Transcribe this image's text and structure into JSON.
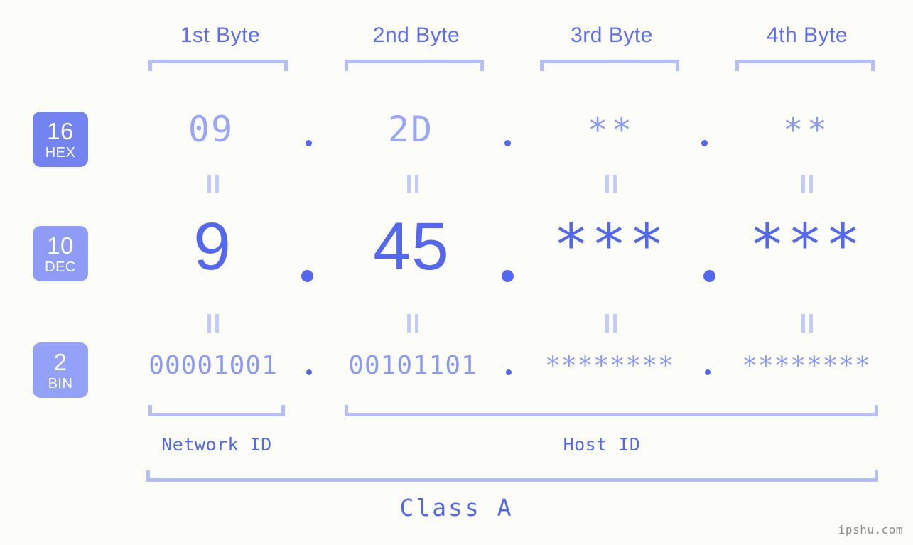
{
  "background_color": "#fcfdf9",
  "accent_strong": "#5368ef",
  "accent_mid": "#8b99f6",
  "accent_light": "#b6bef9",
  "header": {
    "bytes": [
      {
        "label": "1st Byte"
      },
      {
        "label": "2nd Byte"
      },
      {
        "label": "3rd Byte"
      },
      {
        "label": "4th Byte"
      }
    ]
  },
  "bases": [
    {
      "number": "16",
      "name": "HEX",
      "color": "#7384f0"
    },
    {
      "number": "10",
      "name": "DEC",
      "color": "#8f9cf5"
    },
    {
      "number": "2",
      "name": "BIN",
      "color": "#93a2f7"
    }
  ],
  "rows": {
    "hex": {
      "values": [
        "09",
        "2D",
        "**",
        "**"
      ],
      "separator": "."
    },
    "dec": {
      "values": [
        "9",
        "45",
        "***",
        "***"
      ],
      "separator": "."
    },
    "bin": {
      "values": [
        "00001001",
        "00101101",
        "********",
        "********"
      ],
      "separator": "."
    }
  },
  "connector": "=",
  "footer": {
    "network_id_label": "Network ID",
    "host_id_label": "Host ID",
    "class_label": "Class A"
  },
  "watermark": "ipshu.com"
}
